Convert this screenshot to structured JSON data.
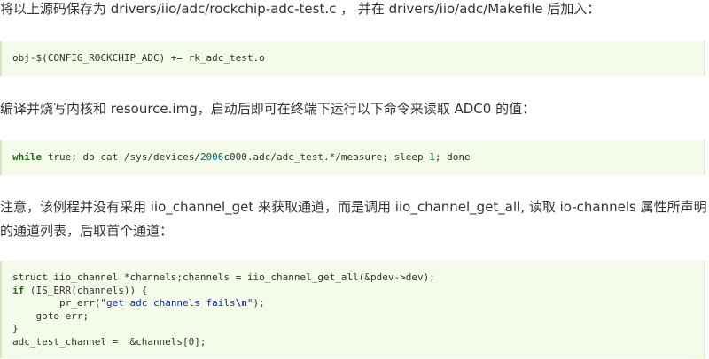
{
  "paragraphs": {
    "p1": "将以上源码保存为 drivers/iio/adc/rockchip-adc-test.c ，  并在 drivers/iio/adc/Makefile 后加入：",
    "p2": "编译并烧写内核和 resource.img，启动后即可在终端下运行以下命令来读取 ADC0 的值：",
    "p3": "注意，该例程并没有采用 iio_channel_get 来获取通道，而是调用 iio_channel_get_all, 读取 io-channels 属性所声明的通道列表，后取首个通道："
  },
  "code1": {
    "line1": "obj-$(CONFIG_ROCKCHIP_ADC) += rk_adc_test.o"
  },
  "code2": {
    "kw_while": "while",
    "t1": " true; do cat /sys/devices/",
    "n1": "2006",
    "t2": "c000.adc/adc_test.*/measure; sleep ",
    "n2": "1",
    "t3": "; done"
  },
  "code3": {
    "l1": "struct iio_channel *channels;channels = iio_channel_get_all(&pdev->dev);",
    "kw_if": "if",
    "l2_rest": " (IS_ERR(channels)) {",
    "l3_pre": "        pr_err(",
    "l3_str": "\"get adc channels fails",
    "l3_esc": "\\n",
    "l3_str_end": "\"",
    "l3_post": ");",
    "l4": "    goto err;",
    "l5": "}",
    "l6": "adc_test_channel =  &channels[0];"
  }
}
